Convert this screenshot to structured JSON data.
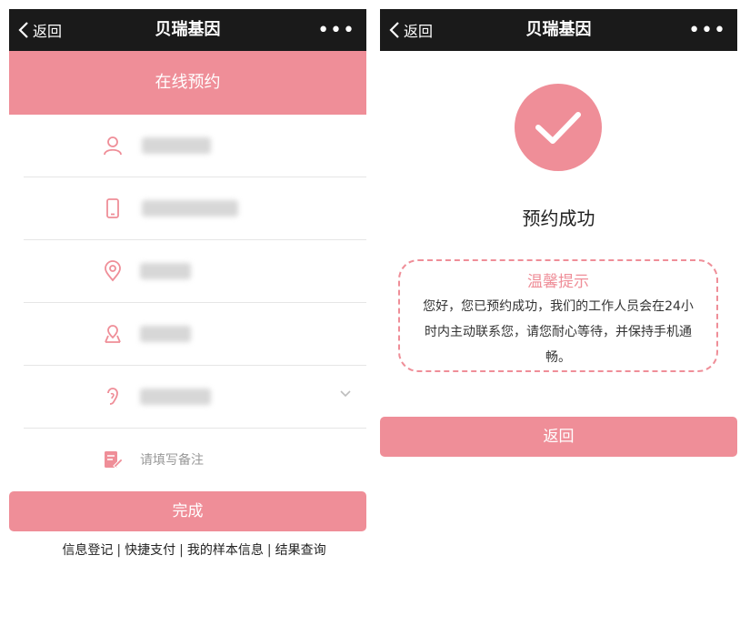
{
  "colors": {
    "accent": "#ef8e98",
    "navbar": "#1a1a1a"
  },
  "left": {
    "navbar": {
      "back_label": "返回",
      "title": "贝瑞基因",
      "more_label": "•••"
    },
    "banner": "在线预约",
    "form": {
      "fields": [
        {
          "icon": "user-icon"
        },
        {
          "icon": "phone-icon"
        },
        {
          "icon": "location-pin-icon"
        },
        {
          "icon": "address-icon"
        },
        {
          "icon": "ear-icon"
        },
        {
          "icon": "note-icon",
          "placeholder": "请填写备注"
        }
      ]
    },
    "done_label": "完成",
    "footer": {
      "links": [
        "信息登记",
        "快捷支付",
        "我的样本信息",
        "结果查询"
      ],
      "separator": "|"
    }
  },
  "right": {
    "navbar": {
      "back_label": "返回",
      "title": "贝瑞基因",
      "more_label": "•••"
    },
    "success_title": "预约成功",
    "tip": {
      "title": "温馨提示",
      "body": "您好，您已预约成功，我们的工作人员会在24小时内主动联系您，请您耐心等待，并保持手机通畅。"
    },
    "back_button_label": "返回"
  }
}
